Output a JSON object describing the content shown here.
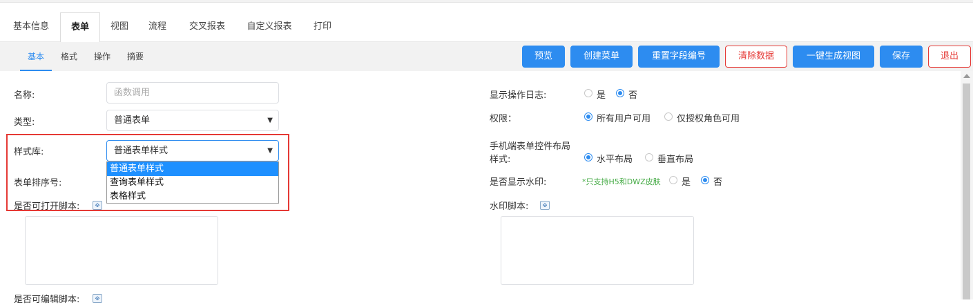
{
  "main_tabs": [
    {
      "label": "基本信息"
    },
    {
      "label": "表单"
    },
    {
      "label": "视图"
    },
    {
      "label": "流程"
    },
    {
      "label": "交叉报表"
    },
    {
      "label": "自定义报表"
    },
    {
      "label": "打印"
    }
  ],
  "sub_tabs": [
    {
      "label": "基本"
    },
    {
      "label": "格式"
    },
    {
      "label": "操作"
    },
    {
      "label": "摘要"
    }
  ],
  "toolbar": {
    "preview": "预览",
    "create_menu": "创建菜单",
    "reset_field_numbers": "重置字段编号",
    "clear_data": "清除数据",
    "generate_view": "一键生成视图",
    "save": "保存",
    "exit": "退出"
  },
  "form": {
    "name_label": "名称:",
    "name_placeholder": "函数调用",
    "type_label": "类型:",
    "type_value": "普通表单",
    "style_label": "样式库:",
    "style_value": "普通表单样式",
    "style_options": [
      "普通表单样式",
      "查询表单样式",
      "表格样式"
    ],
    "sort_label": "表单排序号:",
    "open_script_label": "是否可打开脚本:",
    "edit_script_label": "是否可编辑脚本:"
  },
  "right_form": {
    "show_log_label": "显示操作日志:",
    "show_log_options": [
      "是",
      "否"
    ],
    "show_log_selected": "否",
    "permission_label": "权限：",
    "permission_options": [
      "所有用户可用",
      "仅授权角色可用"
    ],
    "permission_selected": "所有用户可用",
    "mobile_layout_label_1": "手机端表单控件布局",
    "mobile_layout_label_2": "样式:",
    "mobile_layout_options": [
      "水平布局",
      "垂直布局"
    ],
    "mobile_layout_selected": "水平布局",
    "watermark_label": "是否显示水印:",
    "watermark_note": "*只支持H5和DWZ皮肤",
    "watermark_options": [
      "是",
      "否"
    ],
    "watermark_selected": "否",
    "watermark_script_label": "水印脚本:"
  },
  "icons": {
    "script_icon_glyph": "⟐"
  },
  "colors": {
    "accent": "#2d8cf0",
    "danger": "#e53935",
    "highlight_box": "#e53935",
    "note": "#44aa44"
  }
}
